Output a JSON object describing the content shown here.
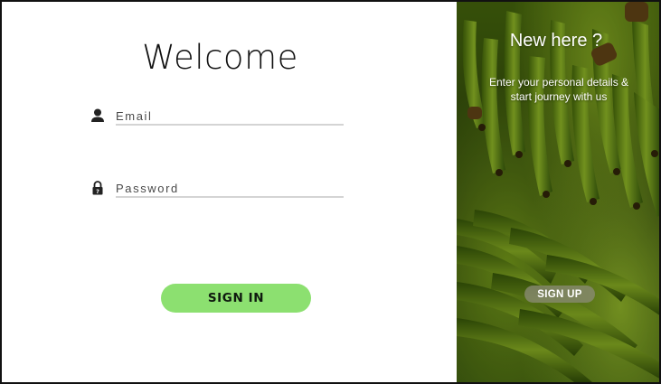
{
  "signin": {
    "title": "Welcome",
    "email": {
      "placeholder": "Email",
      "value": "",
      "icon": "user-icon"
    },
    "password": {
      "placeholder": "Password",
      "value": "",
      "icon": "lock-icon"
    },
    "submit_label": "SIGN IN"
  },
  "signup_panel": {
    "title": "New here ?",
    "text": "Enter your personal details & start journey with us",
    "button_label": "SIGN UP",
    "background": "bananas-photo"
  },
  "colors": {
    "signin_button": "#8ce070",
    "signup_button": "#8c8c78",
    "input_underline": "#d4d4d4",
    "panel_green": "#4f7012"
  }
}
